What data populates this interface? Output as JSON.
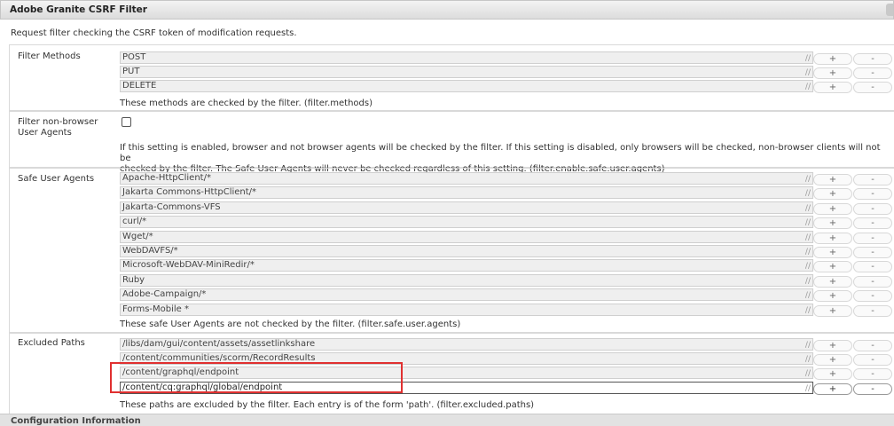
{
  "section": {
    "title": "Adobe Granite CSRF Filter",
    "description": "Request filter checking the CSRF token of modification requests."
  },
  "buttons": {
    "add": "+",
    "remove": "-"
  },
  "filter_methods": {
    "label": "Filter Methods",
    "values": [
      "POST",
      "PUT",
      "DELETE"
    ],
    "hint": "These methods are checked by the filter. (filter.methods)"
  },
  "non_browser": {
    "label_line1": "Filter non-browser",
    "label_line2": "User Agents",
    "checked": false,
    "hint_line1": "If this setting is enabled, browser and not browser agents will be checked by the filter. If this setting is disabled, only browsers will be checked, non-browser clients will not be",
    "hint_line2": "checked by the filter. The Safe User Agents will never be checked regardless of this setting. (filter.enable.safe.user.agents)"
  },
  "safe_user_agents": {
    "label": "Safe User Agents",
    "values": [
      "Apache-HttpClient/*",
      "Jakarta Commons-HttpClient/*",
      "Jakarta-Commons-VFS",
      "curl/*",
      "Wget/*",
      "WebDAVFS/*",
      "Microsoft-WebDAV-MiniRedir/*",
      "Ruby",
      "Adobe-Campaign/*",
      "Forms-Mobile *"
    ],
    "hint": "These safe User Agents are not checked by the filter. (filter.safe.user.agents)"
  },
  "excluded_paths": {
    "label": "Excluded Paths",
    "values": [
      "/libs/dam/gui/content/assets/assetlinkshare",
      "/content/communities/scorm/RecordResults",
      "/content/graphql/endpoint",
      "/content/cq:graphql/global/endpoint"
    ],
    "hint": "These paths are excluded by the filter. Each entry is of the form 'path'. (filter.excluded.paths)"
  },
  "next_section": {
    "title": "Configuration Information"
  },
  "colors": {
    "highlight": "#e03030",
    "header_bg": "#dcdcdc"
  }
}
